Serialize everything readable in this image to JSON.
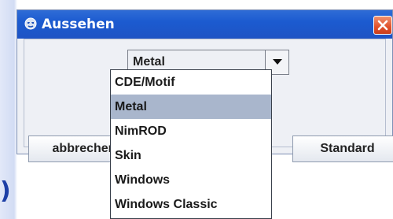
{
  "window": {
    "title": "Aussehen"
  },
  "backdrop": {
    "fragment_text": ")"
  },
  "lookandfeel_combo": {
    "selected_value": "Metal"
  },
  "dropdown": {
    "items": [
      {
        "label": "CDE/Motif",
        "selected": false
      },
      {
        "label": "Metal",
        "selected": true
      },
      {
        "label": "NimROD",
        "selected": false
      },
      {
        "label": "Skin",
        "selected": false
      },
      {
        "label": "Windows",
        "selected": false
      },
      {
        "label": "Windows Classic",
        "selected": false
      }
    ]
  },
  "buttons": {
    "cancel_label": "abbrechen",
    "default_label": "Standard"
  },
  "colors": {
    "titlebar": "#1c5bd0",
    "close_button": "#e0512b",
    "selection_highlight": "#a9b6cc"
  },
  "icons": {
    "title_icon": "app-icon",
    "close_icon": "close-icon",
    "dropdown_icon": "chevron-down-icon"
  }
}
